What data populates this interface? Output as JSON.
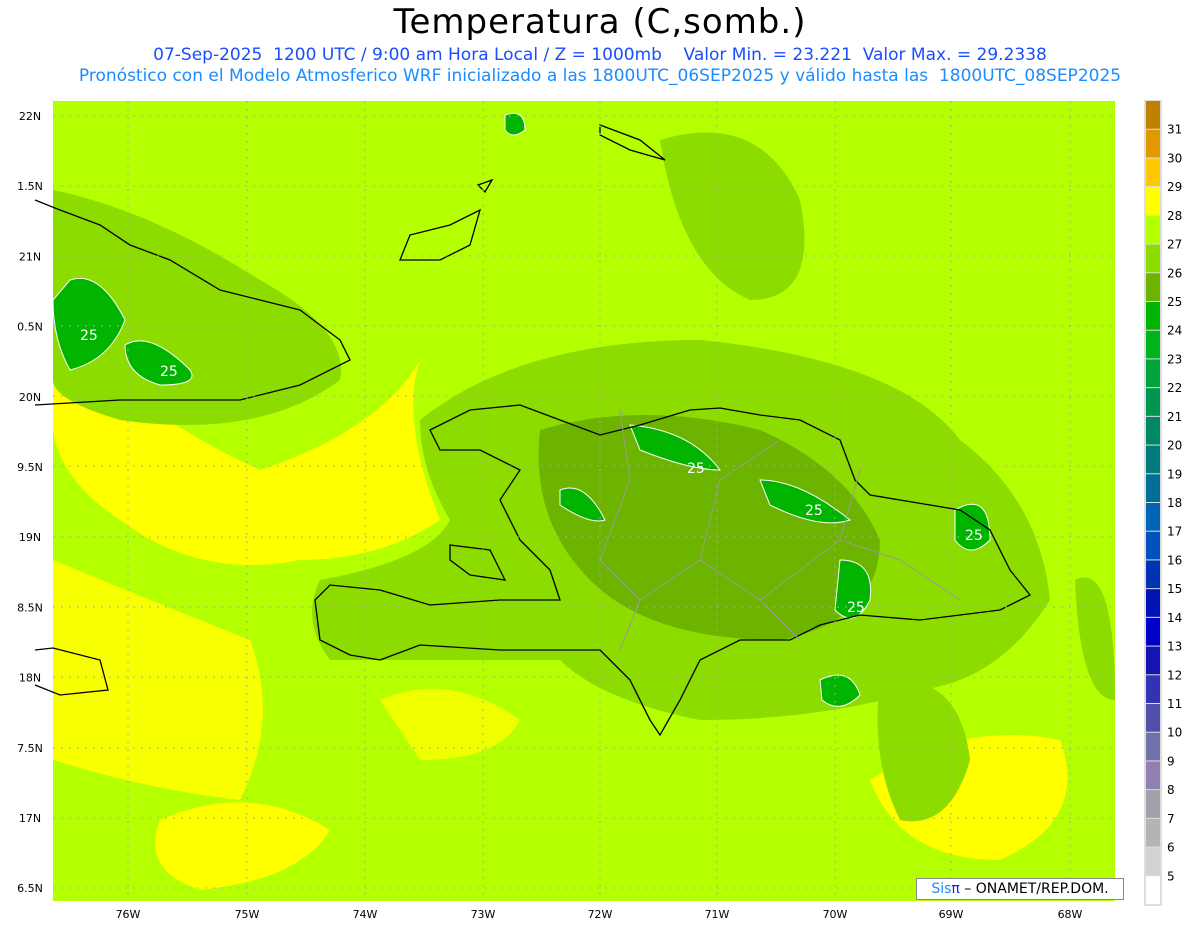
{
  "header": {
    "title": "Temperatura (C,somb.)",
    "line1": "07-Sep-2025  1200 UTC / 9:00 am Hora Local / Z = 1000mb    Valor Min. = 23.221  Valor Max. = 29.2338",
    "line2": "Pronóstico con el Modelo Atmosferico WRF inicializado a las 1800UTC_06SEP2025 y válido hasta las  1800UTC_08SEP2025"
  },
  "map": {
    "lon_labels": [
      "76W",
      "75W",
      "74W",
      "73W",
      "72W",
      "71W",
      "70W",
      "69W",
      "68W"
    ],
    "lat_labels": [
      "22N",
      "1.5N",
      "21N",
      "0.5N",
      "20N",
      "9.5N",
      "19N",
      "8.5N",
      "18N",
      "7.5N",
      "17N",
      "6.5N"
    ],
    "contour_labels": [
      "25",
      "25",
      "25",
      "25",
      "25",
      "25"
    ]
  },
  "colorbar": {
    "labels": [
      "31",
      "30",
      "29",
      "28",
      "27",
      "26",
      "25",
      "24",
      "23",
      "22",
      "21",
      "20",
      "19",
      "18",
      "17",
      "16",
      "15",
      "14",
      "13",
      "12",
      "11",
      "10",
      "9",
      "8",
      "7",
      "6",
      "5"
    ],
    "colors": [
      "#c08000",
      "#e09a00",
      "#ffc800",
      "#ffff00",
      "#b4ff00",
      "#8cdc00",
      "#6cb400",
      "#00b400",
      "#00b41e",
      "#00a43c",
      "#009650",
      "#008864",
      "#007a7a",
      "#006e96",
      "#0064b4",
      "#0050be",
      "#0032b4",
      "#0014b4",
      "#0000c8",
      "#1414b4",
      "#3232b4",
      "#5050aa",
      "#7070aa",
      "#9080b4",
      "#a0a0a8",
      "#b4b4b4",
      "#d2d2d2",
      "#ffffff"
    ]
  },
  "credit": {
    "brand_a": "Sis",
    "brand_b": "π",
    "rest": " – ONAMET/REP.DOM."
  }
}
